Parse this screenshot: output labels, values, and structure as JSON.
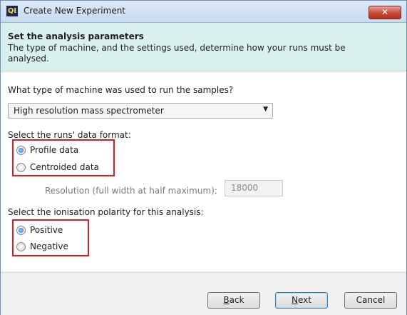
{
  "window": {
    "title": "Create New Experiment",
    "app_icon_text": "QI",
    "close_label": "✕"
  },
  "header": {
    "title": "Set the analysis parameters",
    "description": "The type of machine, and the settings used, determine how your runs must be analysed."
  },
  "machine": {
    "question": "What type of machine was used to run the samples?",
    "selected": "High resolution mass spectrometer"
  },
  "data_format": {
    "question": "Select the runs' data format:",
    "options": [
      {
        "label": "Profile data",
        "checked": true
      },
      {
        "label": "Centroided data",
        "checked": false
      }
    ],
    "resolution_label": "Resolution (full width at half maximum):",
    "resolution_value": "18000"
  },
  "polarity": {
    "question": "Select the ionisation polarity for this analysis:",
    "options": [
      {
        "label": "Positive",
        "checked": true
      },
      {
        "label": "Negative",
        "checked": false
      }
    ]
  },
  "footer": {
    "back_mnemonic": "B",
    "back_rest": "ack",
    "next_mnemonic": "N",
    "next_rest": "ext",
    "cancel": "Cancel"
  },
  "colors": {
    "highlight": "#e0191e",
    "header_band": "#d9f1ee",
    "radio_selected": "#2a6fb6"
  }
}
